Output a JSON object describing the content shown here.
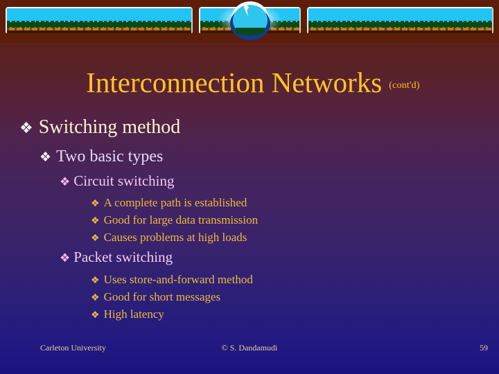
{
  "slide": {
    "title": "Interconnection Networks",
    "title_suffix": "(cont'd)",
    "accent_title_color": "#ffc425",
    "background_top_color": "#5c1d09",
    "background_bottom_color": "#1b1280",
    "bullet_glyph": "❖"
  },
  "banner": {
    "panels": [
      {
        "name": "left-landscape-panel"
      },
      {
        "name": "middle-landscape-panel"
      },
      {
        "name": "right-landscape-panel"
      }
    ],
    "globe": "globe-graphic",
    "sky_color": "#22c4f5",
    "vegetation_color": "#0a4a18",
    "ground_color": "#c8761b"
  },
  "outline": [
    {
      "level": 1,
      "text": "Switching method",
      "color": "#fdf3cf"
    },
    {
      "level": 2,
      "text": "Two basic types",
      "color": "#e5dcf6"
    },
    {
      "level": 3,
      "text": "Circuit switching",
      "color": "#f3c9ef"
    },
    {
      "level": 4,
      "text": "A complete path is established",
      "color": "#f0b93c"
    },
    {
      "level": 4,
      "text": "Good for large data transmission",
      "color": "#f0b93c"
    },
    {
      "level": 4,
      "text": "Causes problems at high loads",
      "color": "#f0b93c"
    },
    {
      "level": 3,
      "text": "Packet switching",
      "color": "#f3c9ef"
    },
    {
      "level": 4,
      "text": "Uses store-and-forward method",
      "color": "#f0b93c"
    },
    {
      "level": 4,
      "text": "Good for short messages",
      "color": "#f0b93c"
    },
    {
      "level": 4,
      "text": "High latency",
      "color": "#f0b93c"
    }
  ],
  "footer": {
    "organization": "Carleton University",
    "copyright": "© S. Dandamudi",
    "page_number": "59",
    "text_color": "#e8cf9a"
  }
}
